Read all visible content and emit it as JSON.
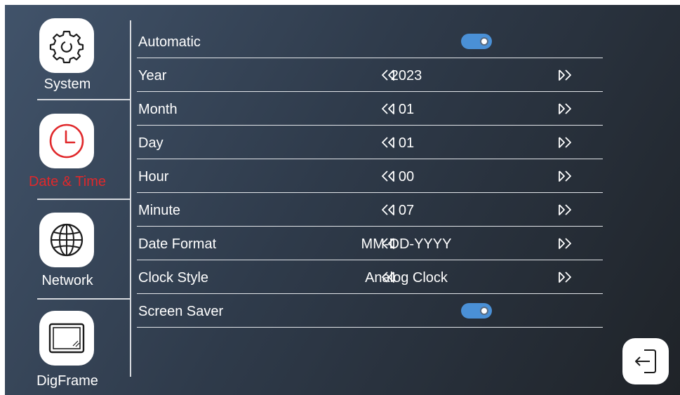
{
  "sidebar": {
    "items": [
      {
        "label": "System",
        "icon": "gear-icon",
        "active": false
      },
      {
        "label": "Date & Time",
        "icon": "clock-icon",
        "active": true
      },
      {
        "label": "Network",
        "icon": "globe-icon",
        "active": false
      },
      {
        "label": "DigFrame",
        "icon": "picture-frame-icon",
        "active": false
      }
    ]
  },
  "settings": {
    "automatic": {
      "label": "Automatic",
      "toggle_on": true
    },
    "year": {
      "label": "Year",
      "value": "2023"
    },
    "month": {
      "label": "Month",
      "value": "01"
    },
    "day": {
      "label": "Day",
      "value": "01"
    },
    "hour": {
      "label": "Hour",
      "value": "00"
    },
    "minute": {
      "label": "Minute",
      "value": "07"
    },
    "date_format": {
      "label": "Date Format",
      "value": "MM-DD-YYYY"
    },
    "clock_style": {
      "label": "Clock Style",
      "value": "Analog Clock"
    },
    "screen_saver": {
      "label": "Screen Saver",
      "toggle_on": true
    }
  },
  "icons": {
    "prev": "double-chevron-left-icon",
    "next": "double-chevron-right-icon",
    "exit": "exit-icon"
  },
  "colors": {
    "active_label": "#e0282b",
    "toggle_on": "#4a90d6",
    "background_start": "#41536a",
    "background_end": "#1f2328"
  }
}
